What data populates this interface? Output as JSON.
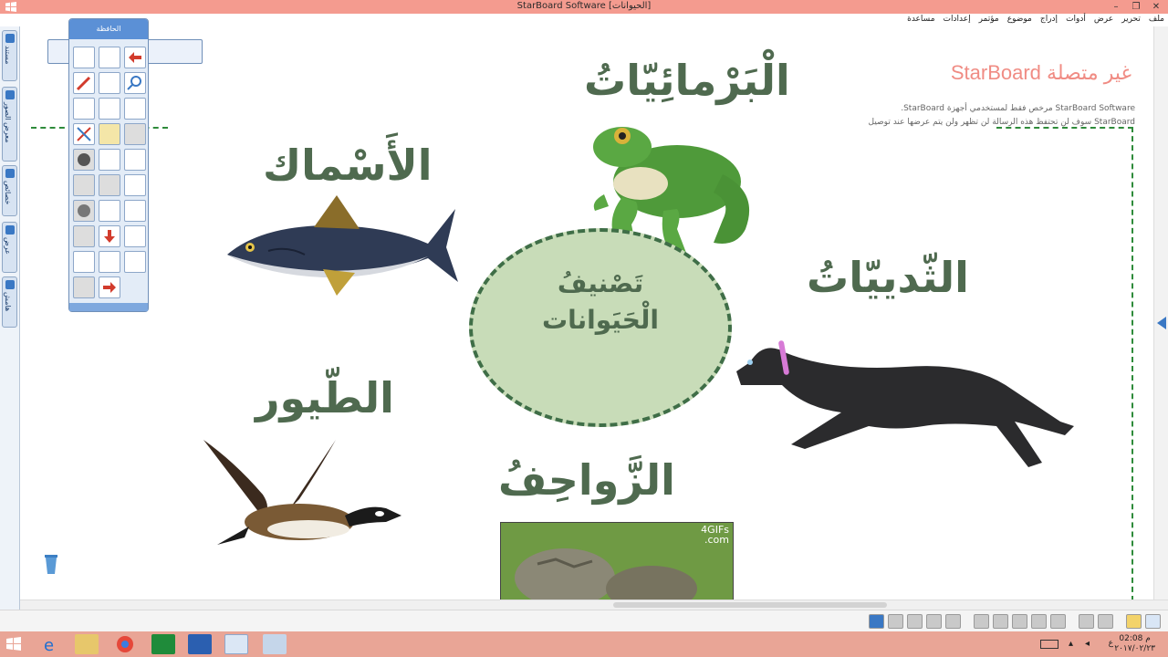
{
  "window": {
    "title": "StarBoard Software [الحيوانات]"
  },
  "menubar": {
    "items": [
      "ملف",
      "تحرير",
      "عرض",
      "أدوات",
      "إدراج",
      "موضوع",
      "مؤتمر",
      "إعدادات",
      "مساعدة"
    ]
  },
  "left_tabs": [
    "مستند",
    "معرض الصور",
    "خصائص",
    "عرض",
    "هامش"
  ],
  "toolbox": {
    "title": "الحافظة"
  },
  "status": {
    "offline_label": "غير متصلة StarBoard",
    "license_line1": "StarBoard Software مرخص فقط لمستخدمي أجهزة StarBoard.",
    "license_line2": "StarBoard سوف لن تحتفظ هذه الرسالة لن تظهر ولن يتم عرضها عند توصيل"
  },
  "slide": {
    "amphibians": "الْبَرْمائِيّاتُ",
    "fish": "الأَسْماك",
    "mammals": "الثّدييّاتُ",
    "birds": "الطّيور",
    "reptiles": "الزَّواحِفُ",
    "center_line1": "تَصْنيفُ",
    "center_line2": "الْحَيَوانات",
    "gif_watermark_1": "4GIFs",
    "gif_watermark_2": ".com"
  },
  "taskbar": {
    "time": "02:08 م",
    "date": "٢٠١٧/٠٢/٢٣",
    "lang": "ع"
  }
}
